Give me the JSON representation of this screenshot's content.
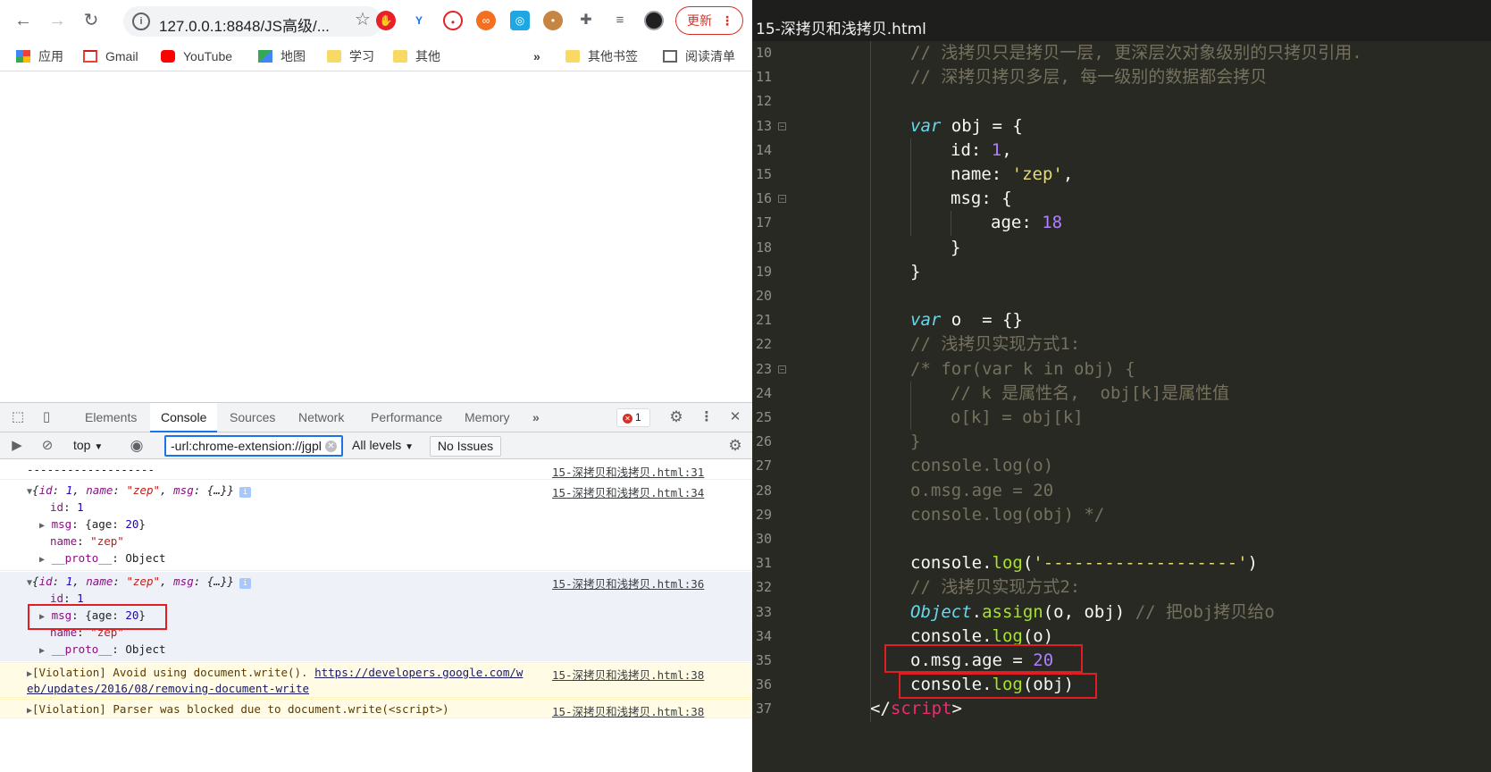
{
  "browser": {
    "url": "127.0.0.1:8848/JS高级/...",
    "update_label": "更新",
    "bookmarks": [
      {
        "label": "应用",
        "icon": "apps-grid-icon"
      },
      {
        "label": "Gmail",
        "icon": "gmail-icon"
      },
      {
        "label": "YouTube",
        "icon": "youtube-icon"
      },
      {
        "label": "地图",
        "icon": "maps-icon"
      },
      {
        "label": "学习",
        "icon": "folder-icon"
      },
      {
        "label": "其他",
        "icon": "folder-icon"
      }
    ],
    "more_bookmarks": "»",
    "other_bookmarks": "其他书签",
    "reading_list": "阅读清单"
  },
  "devtools": {
    "tabs": [
      "Elements",
      "Console",
      "Sources",
      "Network",
      "Performance",
      "Memory"
    ],
    "active_tab": "Console",
    "more_tabs": "»",
    "error_count": "1",
    "context": "top",
    "filter_value": "-url:chrome-extension://jgpl",
    "levels": "All levels",
    "issues": "No Issues",
    "rows": {
      "r1": {
        "text": "-------------------",
        "src": "15-深拷贝和浅拷贝.html:31"
      },
      "r2": {
        "src": "15-深拷贝和浅拷贝.html:34",
        "preview_open": "{",
        "k_id": "id",
        "v_id": "1",
        "k_name": "name",
        "v_name": "\"zep\"",
        "k_msg": "msg",
        "v_msg_preview": "{…}}",
        "id_line_key": "id",
        "id_line_val": "1",
        "msg_line_key": "msg",
        "msg_line_age_key": "age",
        "msg_line_age_val": "20",
        "name_line_key": "name",
        "name_line_val": "\"zep\"",
        "proto_key": "__proto__",
        "proto_val": "Object"
      },
      "r3": {
        "src": "15-深拷贝和浅拷贝.html:36",
        "k_id": "id",
        "v_id": "1",
        "k_name": "name",
        "v_name": "\"zep\"",
        "k_msg": "msg",
        "v_msg_preview": "{…}}",
        "id_line_key": "id",
        "id_line_val": "1",
        "msg_line_key": "msg",
        "msg_line_age_key": "age",
        "msg_line_age_val": "20",
        "name_line_key": "name",
        "name_line_val": "\"zep\"",
        "proto_key": "__proto__",
        "proto_val": "Object"
      },
      "r4": {
        "prefix": "[Violation] Avoid using document.write(). ",
        "link1": "https://developers.google.com/w",
        "link2": "eb/updates/2016/08/removing-document-write",
        "src": "15-深拷贝和浅拷贝.html:38"
      },
      "r5": {
        "text": "[Violation] Parser was blocked due to document.write(<script>)",
        "src": "15-深拷贝和浅拷贝.html:38"
      }
    }
  },
  "editor": {
    "filename": "15-深拷贝和浅拷贝.html",
    "lines": [
      {
        "n": "10",
        "fold": false,
        "indent": 0,
        "tokens": [
          [
            "c-com",
            "// 浅拷贝只是拷贝一层, 更深层次对象级别的只拷贝引用."
          ]
        ]
      },
      {
        "n": "11",
        "fold": false,
        "indent": 0,
        "tokens": [
          [
            "c-com",
            "// 深拷贝拷贝多层, 每一级别的数据都会拷贝"
          ]
        ]
      },
      {
        "n": "12",
        "fold": false,
        "indent": 0,
        "tokens": []
      },
      {
        "n": "13",
        "fold": true,
        "indent": 0,
        "tokens": [
          [
            "c-kw",
            "var"
          ],
          [
            "c-plain",
            " obj = {"
          ]
        ]
      },
      {
        "n": "14",
        "fold": false,
        "indent": 1,
        "tokens": [
          [
            "c-plain",
            "id: "
          ],
          [
            "c-num",
            "1"
          ],
          [
            "c-plain",
            ","
          ]
        ]
      },
      {
        "n": "15",
        "fold": false,
        "indent": 1,
        "tokens": [
          [
            "c-plain",
            "name: "
          ],
          [
            "c-str",
            "'zep'"
          ],
          [
            "c-plain",
            ","
          ]
        ]
      },
      {
        "n": "16",
        "fold": true,
        "indent": 1,
        "tokens": [
          [
            "c-plain",
            "msg: {"
          ]
        ]
      },
      {
        "n": "17",
        "fold": false,
        "indent": 2,
        "tokens": [
          [
            "c-plain",
            "age: "
          ],
          [
            "c-num",
            "18"
          ]
        ]
      },
      {
        "n": "18",
        "fold": false,
        "indent": 1,
        "tokens": [
          [
            "c-plain",
            "}"
          ]
        ]
      },
      {
        "n": "19",
        "fold": false,
        "indent": 0,
        "tokens": [
          [
            "c-plain",
            "}"
          ]
        ]
      },
      {
        "n": "20",
        "fold": false,
        "indent": 0,
        "tokens": []
      },
      {
        "n": "21",
        "fold": false,
        "indent": 0,
        "tokens": [
          [
            "c-kw",
            "var"
          ],
          [
            "c-plain",
            " o  = {}"
          ]
        ]
      },
      {
        "n": "22",
        "fold": false,
        "indent": 0,
        "tokens": [
          [
            "c-com",
            "// 浅拷贝实现方式1:"
          ]
        ]
      },
      {
        "n": "23",
        "fold": true,
        "indent": 0,
        "tokens": [
          [
            "c-com",
            "/* for(var k in obj) {"
          ]
        ]
      },
      {
        "n": "24",
        "fold": false,
        "indent": 1,
        "tokens": [
          [
            "c-com",
            "// k 是属性名,  obj[k]是属性值"
          ]
        ]
      },
      {
        "n": "25",
        "fold": false,
        "indent": 1,
        "tokens": [
          [
            "c-com",
            "o[k] = obj[k]"
          ]
        ]
      },
      {
        "n": "26",
        "fold": false,
        "indent": 0,
        "tokens": [
          [
            "c-com",
            "}"
          ]
        ]
      },
      {
        "n": "27",
        "fold": false,
        "indent": 0,
        "tokens": [
          [
            "c-com",
            "console.log(o)"
          ]
        ]
      },
      {
        "n": "28",
        "fold": false,
        "indent": 0,
        "tokens": [
          [
            "c-com",
            "o.msg.age = 20"
          ]
        ]
      },
      {
        "n": "29",
        "fold": false,
        "indent": 0,
        "tokens": [
          [
            "c-com",
            "console.log(obj) */"
          ]
        ]
      },
      {
        "n": "30",
        "fold": false,
        "indent": 0,
        "tokens": []
      },
      {
        "n": "31",
        "fold": false,
        "indent": 0,
        "tokens": [
          [
            "c-plain",
            "console."
          ],
          [
            "c-fn",
            "log"
          ],
          [
            "c-plain",
            "("
          ],
          [
            "c-str",
            "'-------------------'"
          ],
          [
            "c-plain",
            ")"
          ]
        ]
      },
      {
        "n": "32",
        "fold": false,
        "indent": 0,
        "tokens": [
          [
            "c-com",
            "// 浅拷贝实现方式2:"
          ]
        ]
      },
      {
        "n": "33",
        "fold": false,
        "indent": 0,
        "tokens": [
          [
            "c-obj",
            "Object"
          ],
          [
            "c-plain",
            "."
          ],
          [
            "c-fn",
            "assign"
          ],
          [
            "c-plain",
            "(o, obj) "
          ],
          [
            "c-com",
            "// 把obj拷贝给o"
          ]
        ]
      },
      {
        "n": "34",
        "fold": false,
        "indent": 0,
        "tokens": [
          [
            "c-plain",
            "console."
          ],
          [
            "c-fn",
            "log"
          ],
          [
            "c-plain",
            "(o)"
          ]
        ]
      },
      {
        "n": "35",
        "fold": false,
        "indent": 0,
        "tokens": [
          [
            "c-plain",
            "o.msg.age = "
          ],
          [
            "c-num",
            "20"
          ]
        ]
      },
      {
        "n": "36",
        "fold": false,
        "indent": 0,
        "tokens": [
          [
            "c-plain",
            "console."
          ],
          [
            "c-fn",
            "log"
          ],
          [
            "c-plain",
            "(obj)"
          ]
        ]
      },
      {
        "n": "37",
        "fold": false,
        "indent": -1,
        "tokens": [
          [
            "c-plain",
            "</"
          ],
          [
            "c-tag",
            "script"
          ],
          [
            "c-plain",
            ">"
          ]
        ]
      }
    ]
  }
}
